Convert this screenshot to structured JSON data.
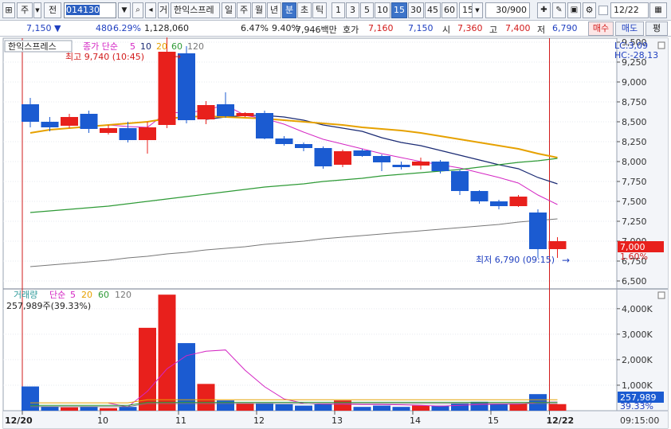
{
  "toolbar": {
    "market": "주",
    "period_btn": "전",
    "code": "014130",
    "name_btn": "거",
    "name": "한익스프레",
    "intervals": [
      "일",
      "주",
      "월",
      "년",
      "분",
      "초",
      "틱"
    ],
    "numbers": [
      "1",
      "3",
      "5",
      "10",
      "15",
      "30",
      "45",
      "60"
    ],
    "interval_value": "15",
    "count": "30/900",
    "date": "12/22"
  },
  "quote": {
    "price": "7,150 ▼",
    "change": "480",
    "change_pct": "-6.29%",
    "volume": "1,128,060",
    "vol_ratio": "6.47%",
    "turnover": "9.40%",
    "amount": "7,946백만",
    "hoga_label": "호가",
    "hoga_ask": "7,160",
    "hoga_bid": "7,150",
    "open_label": "시",
    "open": "7,360",
    "high_label": "고",
    "high": "7,400",
    "low_label": "저",
    "low": "6,790",
    "buy": "매수",
    "sell": "매도",
    "eval": "평"
  },
  "price_pane": {
    "stock_name": "한익스프레스",
    "legend": {
      "type": "종가 단순",
      "p1": "5",
      "p2": "10",
      "p3": "20",
      "p4": "60",
      "p5": "120"
    },
    "high_note": "최고 9,740 (10:45)",
    "low_note": "최저 6,790 (09:15)",
    "lc": "LC:3,09",
    "hc": "HC:-28,13",
    "last_price": "7,000",
    "last_pct": "1.60%"
  },
  "volume_pane": {
    "legend": {
      "type": "거래량",
      "ma": "단순",
      "p1": "5",
      "p2": "20",
      "p3": "60",
      "p4": "120"
    },
    "info": "257,989주(39.33%)",
    "last_vol": "257,989",
    "last_pct": "39.33%"
  },
  "time_axis": {
    "start": "12/20",
    "end": "12/22",
    "end_time": "09:15:00"
  },
  "colors": {
    "up": "#e8201c",
    "down": "#1b5bd1",
    "ma5": "#d426c3",
    "ma10": "#1a2a73",
    "ma20": "#e6a100",
    "ma60": "#2e9a36",
    "ma120": "#777777"
  },
  "chart_data": {
    "type": "candlestick",
    "x_labels": [
      "12/20",
      "10",
      "11",
      "12",
      "13",
      "14",
      "15",
      "12/22"
    ],
    "y_ticks": [
      6500,
      6750,
      7000,
      7250,
      7500,
      7750,
      8000,
      8250,
      8500,
      8750,
      9000,
      9250,
      9500
    ],
    "ylim": [
      6450,
      9550
    ],
    "vol_ticks": [
      1000,
      2000,
      3000,
      4000
    ],
    "vol_tick_labels": [
      "1,000K",
      "2,000K",
      "3,000K",
      "4,000K"
    ],
    "vol_ylim": [
      0,
      4650
    ],
    "candles": [
      {
        "o": 8720,
        "h": 8800,
        "l": 8430,
        "c": 8500,
        "v": 950
      },
      {
        "o": 8500,
        "h": 8560,
        "l": 8380,
        "c": 8430,
        "v": 170
      },
      {
        "o": 8450,
        "h": 8600,
        "l": 8420,
        "c": 8560,
        "v": 130
      },
      {
        "o": 8600,
        "h": 8640,
        "l": 8360,
        "c": 8410,
        "v": 150
      },
      {
        "o": 8360,
        "h": 8460,
        "l": 8340,
        "c": 8420,
        "v": 100
      },
      {
        "o": 8420,
        "h": 8500,
        "l": 8240,
        "c": 8270,
        "v": 150
      },
      {
        "o": 8270,
        "h": 8500,
        "l": 8100,
        "c": 8430,
        "v": 3250
      },
      {
        "o": 8460,
        "h": 9740,
        "l": 8420,
        "c": 9380,
        "v": 4550
      },
      {
        "o": 9360,
        "h": 9450,
        "l": 8480,
        "c": 8520,
        "v": 2650
      },
      {
        "o": 8530,
        "h": 8760,
        "l": 8470,
        "c": 8710,
        "v": 1050
      },
      {
        "o": 8720,
        "h": 8870,
        "l": 8550,
        "c": 8570,
        "v": 400
      },
      {
        "o": 8570,
        "h": 8620,
        "l": 8560,
        "c": 8610,
        "v": 300
      },
      {
        "o": 8610,
        "h": 8640,
        "l": 8280,
        "c": 8290,
        "v": 300
      },
      {
        "o": 8290,
        "h": 8320,
        "l": 8200,
        "c": 8220,
        "v": 250
      },
      {
        "o": 8220,
        "h": 8240,
        "l": 8130,
        "c": 8170,
        "v": 200
      },
      {
        "o": 8170,
        "h": 8190,
        "l": 7910,
        "c": 7940,
        "v": 250
      },
      {
        "o": 7960,
        "h": 8150,
        "l": 7930,
        "c": 8130,
        "v": 400
      },
      {
        "o": 8140,
        "h": 8160,
        "l": 8060,
        "c": 8070,
        "v": 150
      },
      {
        "o": 8070,
        "h": 8090,
        "l": 7880,
        "c": 7990,
        "v": 200
      },
      {
        "o": 7960,
        "h": 8000,
        "l": 7900,
        "c": 7930,
        "v": 150
      },
      {
        "o": 7950,
        "h": 8050,
        "l": 7900,
        "c": 8000,
        "v": 200
      },
      {
        "o": 8000,
        "h": 8020,
        "l": 7850,
        "c": 7880,
        "v": 200
      },
      {
        "o": 7880,
        "h": 7900,
        "l": 7580,
        "c": 7630,
        "v": 300
      },
      {
        "o": 7630,
        "h": 7640,
        "l": 7470,
        "c": 7500,
        "v": 350
      },
      {
        "o": 7500,
        "h": 7520,
        "l": 7400,
        "c": 7440,
        "v": 250
      },
      {
        "o": 7440,
        "h": 7580,
        "l": 7430,
        "c": 7560,
        "v": 300
      },
      {
        "o": 7360,
        "h": 7400,
        "l": 6790,
        "c": 6900,
        "v": 650
      },
      {
        "o": 6900,
        "h": 7050,
        "l": 6790,
        "c": 7000,
        "v": 258
      }
    ],
    "ma_series": [
      {
        "period": "5",
        "values": [
          null,
          null,
          null,
          null,
          8460,
          8440,
          8430,
          8620,
          8610,
          8650,
          8710,
          8580,
          8540,
          8470,
          8370,
          8280,
          8220,
          8160,
          8100,
          8050,
          8000,
          7960,
          7920,
          7860,
          7800,
          7730,
          7580,
          7460
        ]
      },
      {
        "period": "10",
        "values": [
          null,
          null,
          null,
          null,
          null,
          null,
          null,
          null,
          null,
          8530,
          8560,
          8580,
          8580,
          8560,
          8520,
          8460,
          8420,
          8380,
          8300,
          8240,
          8200,
          8140,
          8080,
          8020,
          7960,
          7910,
          7800,
          7720
        ]
      },
      {
        "period": "20",
        "values": [
          8360,
          8400,
          8420,
          8440,
          8460,
          8480,
          8500,
          8540,
          8560,
          8570,
          8560,
          8550,
          8540,
          8520,
          8500,
          8480,
          8460,
          8430,
          8410,
          8390,
          8360,
          8320,
          8280,
          8240,
          8200,
          8160,
          8100,
          8050
        ]
      },
      {
        "period": "60",
        "values": [
          7360,
          7380,
          7400,
          7420,
          7440,
          7470,
          7500,
          7530,
          7560,
          7590,
          7620,
          7650,
          7680,
          7700,
          7720,
          7750,
          7770,
          7790,
          7820,
          7840,
          7860,
          7880,
          7900,
          7930,
          7960,
          7990,
          8010,
          8040
        ]
      },
      {
        "period": "120",
        "values": [
          6680,
          6700,
          6720,
          6740,
          6760,
          6790,
          6810,
          6840,
          6860,
          6890,
          6910,
          6930,
          6960,
          6980,
          7000,
          7030,
          7050,
          7070,
          7090,
          7110,
          7130,
          7150,
          7170,
          7190,
          7210,
          7240,
          7260,
          7280
        ]
      }
    ],
    "vol_ma5": [
      null,
      null,
      null,
      null,
      300,
      150,
      760,
      1640,
      2160,
      2330,
      2380,
      1590,
      940,
      460,
      290,
      260,
      260,
      240,
      240,
      230,
      210,
      180,
      210,
      240,
      260,
      260,
      330,
      340
    ]
  }
}
